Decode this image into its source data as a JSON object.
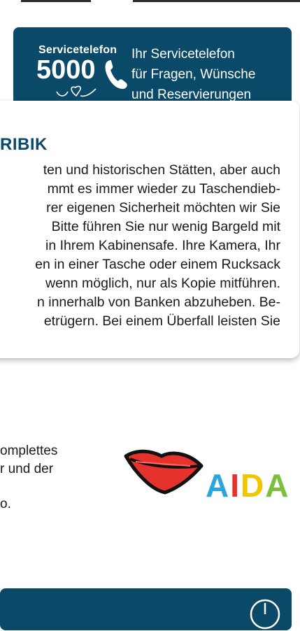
{
  "service": {
    "label": "Servicetelefon",
    "number": "5000",
    "text_lines": [
      "Ihr Servicetelefon",
      "für Fragen, Wünsche",
      "und Reservierungen"
    ]
  },
  "card": {
    "title": "RIBIK",
    "lines": [
      "ten und historischen Stätten, aber auch",
      "mmt es immer wieder zu Taschendieb-",
      "rer eigenen Sicherheit möchten wir Sie",
      "Bitte führen Sie nur wenig Bargeld mit",
      "in Ihrem Kabinensafe. Ihre Kamera, Ihr",
      "en in einer Tasche oder einem Rucksack",
      "wenn möglich, nur als Kopie mitführen.",
      "n innerhalb von Banken abzuheben. Be-",
      "etrügern. Bei einem Überfall leisten Sie"
    ]
  },
  "lower": {
    "lines": [
      "omplettes",
      "r und der"
    ],
    "fragment": "o."
  },
  "logo": {
    "text": "AIDA",
    "letter_colors": [
      "#2aa6dc",
      "#e6322d",
      "#f2c500",
      "#7bbf3c"
    ],
    "lips_color": "#e6322d"
  },
  "colors": {
    "brand": "#0a4a68"
  },
  "icons": {
    "phone": "phone-icon",
    "hearts": "hearts-icon",
    "clock": "clock-icon"
  }
}
